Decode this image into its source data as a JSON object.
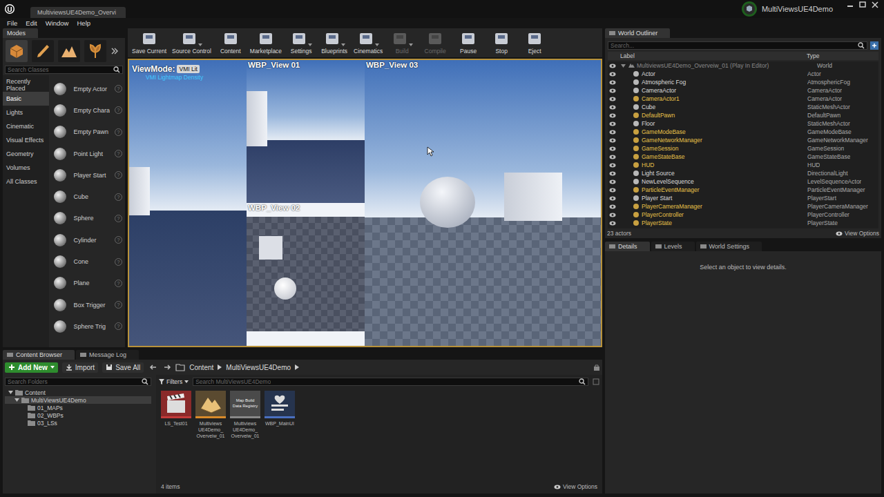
{
  "window": {
    "level_tab": "MultiviewsUE4Demo_Overvi",
    "project": "MultiViewsUE4Demo"
  },
  "menu": [
    "File",
    "Edit",
    "Window",
    "Help"
  ],
  "modes": {
    "tab": "Modes",
    "search_placeholder": "Search Classes",
    "help_glyph": "?",
    "categories": [
      {
        "label": "Recently Placed",
        "selected": false
      },
      {
        "label": "Basic",
        "selected": true
      },
      {
        "label": "Lights",
        "selected": false
      },
      {
        "label": "Cinematic",
        "selected": false
      },
      {
        "label": "Visual Effects",
        "selected": false
      },
      {
        "label": "Geometry",
        "selected": false
      },
      {
        "label": "Volumes",
        "selected": false
      },
      {
        "label": "All Classes",
        "selected": false
      }
    ],
    "items": [
      "Empty Actor",
      "Empty Chara",
      "Empty Pawn",
      "Point Light",
      "Player Start",
      "Cube",
      "Sphere",
      "Cylinder",
      "Cone",
      "Plane",
      "Box Trigger",
      "Sphere Trig"
    ]
  },
  "toolbar": [
    {
      "label": "Save Current",
      "dropdown": false,
      "disabled": false
    },
    {
      "label": "Source Control",
      "dropdown": true,
      "disabled": false
    },
    {
      "label": "Content",
      "dropdown": false,
      "disabled": false
    },
    {
      "label": "Marketplace",
      "dropdown": false,
      "disabled": false
    },
    {
      "label": "Settings",
      "dropdown": true,
      "disabled": false
    },
    {
      "label": "Blueprints",
      "dropdown": true,
      "disabled": false
    },
    {
      "label": "Cinematics",
      "dropdown": true,
      "disabled": false
    },
    {
      "label": "Build",
      "dropdown": true,
      "disabled": true
    },
    {
      "label": "Compile",
      "dropdown": false,
      "disabled": true
    },
    {
      "label": "Pause",
      "dropdown": false,
      "disabled": false
    },
    {
      "label": "Stop",
      "dropdown": false,
      "disabled": false
    },
    {
      "label": "Eject",
      "dropdown": false,
      "disabled": false
    }
  ],
  "viewport": {
    "viewmode_label": "ViewMode:",
    "viewmode": "VMI Lit",
    "subtitle": "VMI Lightmap Density",
    "views": [
      "WBP_View 01",
      "WBP_View 02",
      "WBP_View 03"
    ]
  },
  "outliner": {
    "tab": "World Outliner",
    "search_placeholder": "Search...",
    "columns": [
      "Label",
      "Type"
    ],
    "rows": [
      {
        "label": "MultiviewsUE4Demo_Overveiw_01 (Play In Editor)",
        "type": "World",
        "kind": "world",
        "spawned": false
      },
      {
        "label": "Actor",
        "type": "Actor",
        "kind": "actor",
        "spawned": false
      },
      {
        "label": "Atmospheric Fog",
        "type": "AtmosphericFog",
        "kind": "actor",
        "spawned": false
      },
      {
        "label": "CameraActor",
        "type": "CameraActor",
        "kind": "actor",
        "spawned": false
      },
      {
        "label": "CameraActor1",
        "type": "CameraActor",
        "kind": "actor",
        "spawned": true
      },
      {
        "label": "Cube",
        "type": "StaticMeshActor",
        "kind": "actor",
        "spawned": false
      },
      {
        "label": "DefaultPawn",
        "type": "DefaultPawn",
        "kind": "actor",
        "spawned": true
      },
      {
        "label": "Floor",
        "type": "StaticMeshActor",
        "kind": "actor",
        "spawned": false
      },
      {
        "label": "GameModeBase",
        "type": "GameModeBase",
        "kind": "actor",
        "spawned": true
      },
      {
        "label": "GameNetworkManager",
        "type": "GameNetworkManager",
        "kind": "actor",
        "spawned": true
      },
      {
        "label": "GameSession",
        "type": "GameSession",
        "kind": "actor",
        "spawned": true
      },
      {
        "label": "GameStateBase",
        "type": "GameStateBase",
        "kind": "actor",
        "spawned": true
      },
      {
        "label": "HUD",
        "type": "HUD",
        "kind": "actor",
        "spawned": true
      },
      {
        "label": "Light Source",
        "type": "DirectionalLight",
        "kind": "actor",
        "spawned": false
      },
      {
        "label": "NewLevelSequence",
        "type": "LevelSequenceActor",
        "kind": "actor",
        "spawned": false
      },
      {
        "label": "ParticleEventManager",
        "type": "ParticleEventManager",
        "kind": "actor",
        "spawned": true
      },
      {
        "label": "Player Start",
        "type": "PlayerStart",
        "kind": "actor",
        "spawned": false
      },
      {
        "label": "PlayerCameraManager",
        "type": "PlayerCameraManager",
        "kind": "actor",
        "spawned": true
      },
      {
        "label": "PlayerController",
        "type": "PlayerController",
        "kind": "actor",
        "spawned": true
      },
      {
        "label": "PlayerState",
        "type": "PlayerState",
        "kind": "actor",
        "spawned": true
      }
    ],
    "count": "23 actors",
    "view_options": "View Options"
  },
  "details": {
    "tabs": [
      {
        "label": "Details",
        "selected": true
      },
      {
        "label": "Levels",
        "selected": false
      },
      {
        "label": "World Settings",
        "selected": false
      }
    ],
    "message": "Select an object to view details."
  },
  "content_browser": {
    "tabs": [
      {
        "label": "Content Browser",
        "selected": true
      },
      {
        "label": "Message Log",
        "selected": false
      }
    ],
    "buttons": [
      "Add New",
      "Import",
      "Save All"
    ],
    "path": [
      "Content",
      "MultiViewsUE4Demo"
    ],
    "folder_search_placeholder": "Search Folders",
    "tree": [
      {
        "label": "Content",
        "depth": 0,
        "expanded": true,
        "selected": false
      },
      {
        "label": "MultiViewsUE4Demo",
        "depth": 1,
        "expanded": true,
        "selected": true
      },
      {
        "label": "01_MAPs",
        "depth": 2,
        "expanded": false,
        "selected": false
      },
      {
        "label": "02_WBPs",
        "depth": 2,
        "expanded": false,
        "selected": false
      },
      {
        "label": "03_LSs",
        "depth": 2,
        "expanded": false,
        "selected": false
      }
    ],
    "filters": "Filters",
    "search_placeholder": "Search MultiViewsUE4Demo",
    "assets": [
      {
        "lines": [
          "LS_Test01"
        ],
        "kind": "sequence",
        "thumb_text": ""
      },
      {
        "lines": [
          "Multiviews",
          "UE4Demo_",
          "Overveiw_01"
        ],
        "kind": "map",
        "thumb_text": ""
      },
      {
        "lines": [
          "Multiviews",
          "UE4Demo_",
          "Overveiw_01"
        ],
        "kind": "registry",
        "thumb_text": "Map Build Data Registry"
      },
      {
        "lines": [
          "WBP_MainUI"
        ],
        "kind": "widget",
        "thumb_text": ""
      }
    ],
    "count": "4 items",
    "view_options": "View Options"
  }
}
